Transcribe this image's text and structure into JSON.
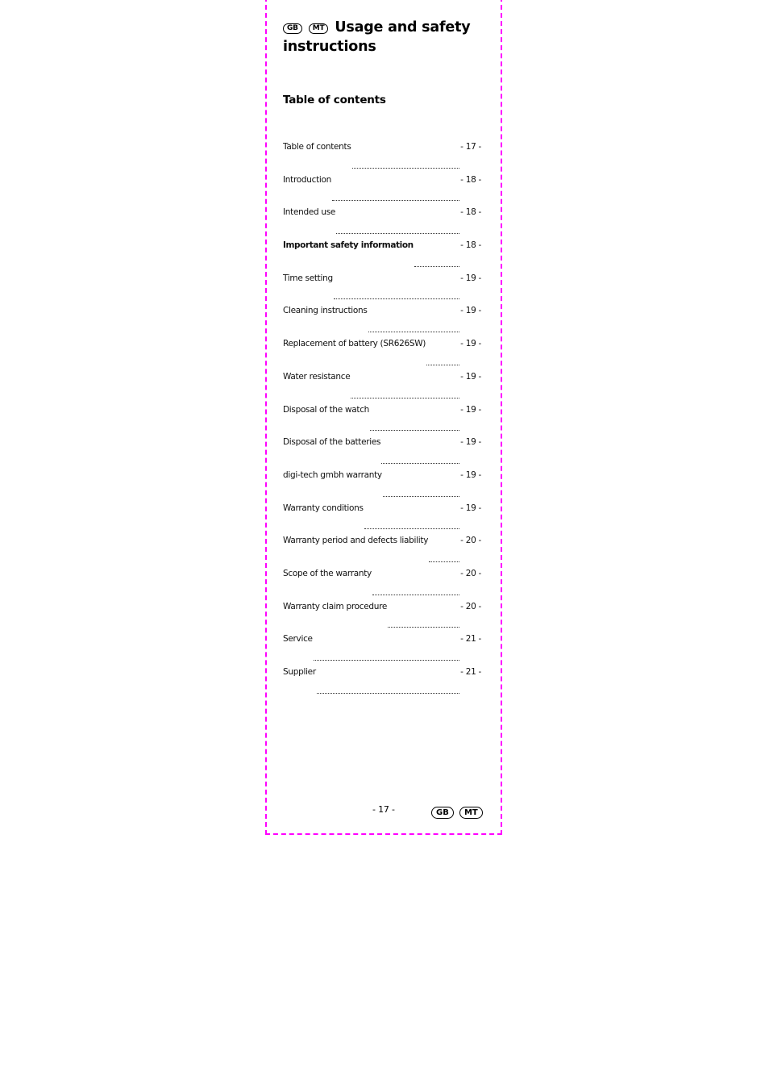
{
  "header": {
    "badges": [
      "GB",
      "MT"
    ],
    "title": "Usage and safety instructions"
  },
  "toc": {
    "heading": "Table of contents",
    "entries": [
      {
        "label": "Table of contents",
        "page": "- 17 -",
        "bold": false
      },
      {
        "label": "Introduction",
        "page": "- 18 -",
        "bold": false
      },
      {
        "label": "Intended use",
        "page": "- 18 -",
        "bold": false
      },
      {
        "label": "Important safety information",
        "page": "- 18 -",
        "bold": true
      },
      {
        "label": "Time setting",
        "page": "- 19 -",
        "bold": false
      },
      {
        "label": "Cleaning instructions",
        "page": "- 19 -",
        "bold": false
      },
      {
        "label": "Replacement of battery (SR626SW)",
        "page": "- 19 -",
        "bold": false
      },
      {
        "label": "Water resistance",
        "page": "- 19 -",
        "bold": false
      },
      {
        "label": "Disposal of the watch",
        "page": "- 19 -",
        "bold": false
      },
      {
        "label": "Disposal of the batteries",
        "page": "- 19 -",
        "bold": false
      },
      {
        "label": "digi-tech gmbh warranty",
        "page": "- 19 -",
        "bold": false
      },
      {
        "label": "Warranty conditions",
        "page": "- 19 -",
        "bold": false
      },
      {
        "label": "Warranty period and defects liability",
        "page": "- 20 -",
        "bold": false
      },
      {
        "label": "Scope of the warranty",
        "page": "- 20 -",
        "bold": false
      },
      {
        "label": "Warranty claim procedure",
        "page": "- 20 -",
        "bold": false
      },
      {
        "label": "Service",
        "page": "- 21 -",
        "bold": false
      },
      {
        "label": "Supplier",
        "page": "- 21 -",
        "bold": false
      }
    ]
  },
  "footer": {
    "page_number": "- 17 -",
    "badges": [
      "GB",
      "MT"
    ]
  },
  "colors": {
    "page_border": "#ff00ff"
  }
}
